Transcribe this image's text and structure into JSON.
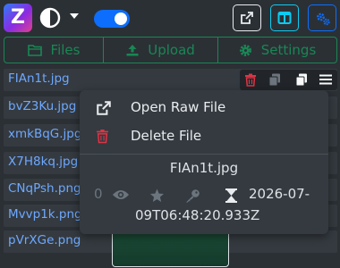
{
  "header": {
    "logo_letter": "Z",
    "dark_mode_toggle_on": true
  },
  "tabs": [
    {
      "label": "Files",
      "icon": "folder-icon"
    },
    {
      "label": "Upload",
      "icon": "upload-icon"
    },
    {
      "label": "Settings",
      "icon": "gear-icon"
    }
  ],
  "files": [
    {
      "name": "FIAn1t.jpg"
    },
    {
      "name": "bvZ3Ku.jpg"
    },
    {
      "name": "xmkBqG.jpg"
    },
    {
      "name": "X7H8kq.jpg"
    },
    {
      "name": "CNqPsh.png"
    },
    {
      "name": "Mvvp1k.png"
    },
    {
      "name": "pVrXGe.png"
    }
  ],
  "menu": {
    "open_raw_label": "Open Raw File",
    "delete_label": "Delete File",
    "file_title": "FIAn1t.jpg",
    "view_count": "0",
    "date_part1": "2026-07-",
    "date_part2": "09T06:48:20.933Z"
  },
  "colors": {
    "accent": "#0d6efd",
    "success": "#198754",
    "danger": "#dc3545",
    "link": "#6ea8fe",
    "info": "#0dcaf0"
  }
}
